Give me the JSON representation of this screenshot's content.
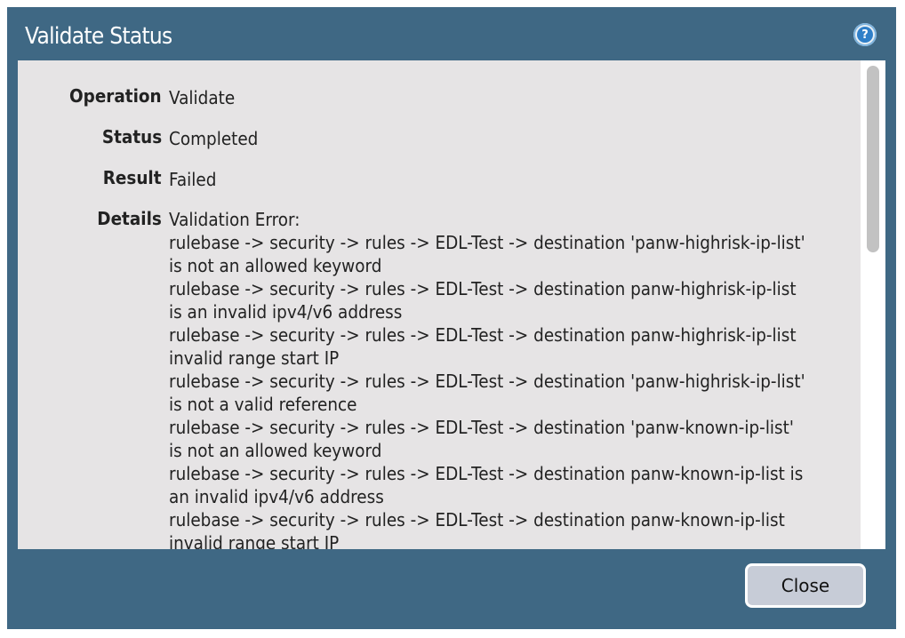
{
  "dialog": {
    "title": "Validate Status",
    "help_icon_glyph": "?",
    "close_label": "Close"
  },
  "fields": {
    "operation": {
      "label": "Operation",
      "value": "Validate"
    },
    "status": {
      "label": "Status",
      "value": "Completed"
    },
    "result": {
      "label": "Result",
      "value": "Failed"
    },
    "details": {
      "label": "Details"
    }
  },
  "details_lines": [
    "Validation Error:",
    "rulebase -> security -> rules -> EDL-Test -> destination 'panw-highrisk-ip-list'",
    "is not an allowed keyword",
    "rulebase -> security -> rules -> EDL-Test -> destination panw-highrisk-ip-list",
    "is an invalid ipv4/v6 address",
    "rulebase -> security -> rules -> EDL-Test -> destination panw-highrisk-ip-list",
    "invalid range start IP",
    "rulebase -> security -> rules -> EDL-Test -> destination 'panw-highrisk-ip-list'",
    "is not a valid reference",
    "rulebase -> security -> rules -> EDL-Test -> destination 'panw-known-ip-list'",
    "is not an allowed keyword",
    "rulebase -> security -> rules -> EDL-Test -> destination panw-known-ip-list is",
    "an invalid ipv4/v6 address",
    "rulebase -> security -> rules -> EDL-Test -> destination panw-known-ip-list",
    "invalid range start IP"
  ],
  "colors": {
    "dialog_bg": "#3f6884",
    "content_bg": "#e6e4e5",
    "button_bg": "#c7ccd7"
  }
}
